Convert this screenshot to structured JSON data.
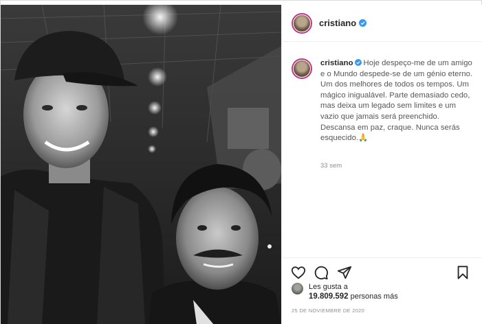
{
  "post": {
    "username": "cristiano",
    "caption_user": "cristiano",
    "caption_text": "Hoje despeço-me de um amigo e o Mundo despede-se de um génio eterno. Um dos melhores de todos os tempos. Um mágico inigualável. Parte demasiado cedo, mas deixa um legado sem limites e um vazio que jamais será preenchido. Descansa em paz, craque. Nunca serás esquecido.",
    "caption_emoji": "🙏",
    "time_ago": "33 sem",
    "likes_prefix": "Les gusta a",
    "likes_count": "19.809.592",
    "likes_suffix": "personas más",
    "date": "25 DE NOVIEMBRE DE 2020"
  },
  "icons": {
    "verified": "verified-badge-icon",
    "like": "heart-icon",
    "comment": "comment-icon",
    "share": "paper-plane-icon",
    "save": "bookmark-icon"
  },
  "colors": {
    "verified_blue": "#3897f0",
    "text": "#262626",
    "muted": "#8e8e8e",
    "border": "#efefef"
  }
}
